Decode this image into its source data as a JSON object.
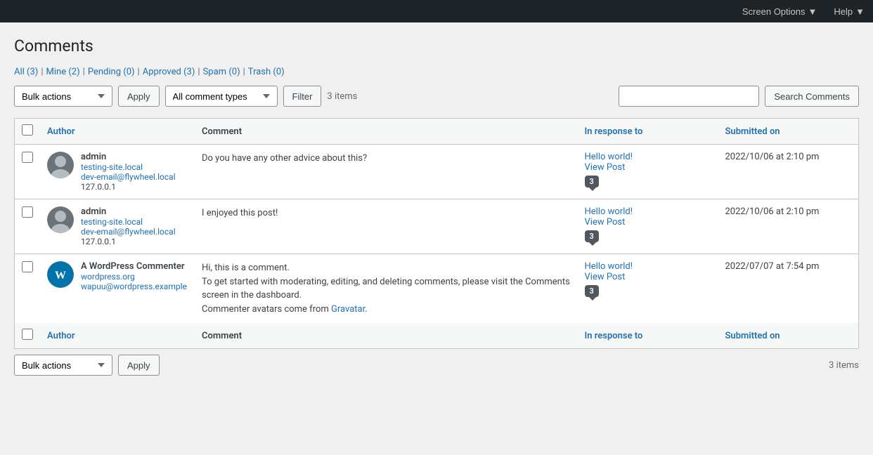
{
  "topbar": {
    "screen_options_label": "Screen Options",
    "help_label": "Help"
  },
  "page": {
    "title": "Comments"
  },
  "filters": {
    "all_label": "All",
    "all_count": "(3)",
    "mine_label": "Mine",
    "mine_count": "(2)",
    "pending_label": "Pending",
    "pending_count": "(0)",
    "approved_label": "Approved",
    "approved_count": "(3)",
    "spam_label": "Spam",
    "spam_count": "(0)",
    "trash_label": "Trash",
    "trash_count": "(0)"
  },
  "toolbar_top": {
    "bulk_actions_label": "Bulk actions",
    "apply_label": "Apply",
    "comment_type_label": "All comment types",
    "filter_label": "Filter",
    "items_count": "3 items",
    "search_placeholder": "",
    "search_button_label": "Search Comments"
  },
  "table": {
    "col_author": "Author",
    "col_comment": "Comment",
    "col_response": "In response to",
    "col_submitted": "Submitted on"
  },
  "comments": [
    {
      "id": 1,
      "author_name": "admin",
      "author_site": "testing-site.local",
      "author_email": "dev-email@flywheel.local",
      "author_ip": "127.0.0.1",
      "comment_text": "Do you have any other advice about this?",
      "response_title": "Hello world!",
      "response_link": "View Post",
      "response_count": "3",
      "submitted": "2022/10/06 at 2:10 pm",
      "avatar_type": "admin"
    },
    {
      "id": 2,
      "author_name": "admin",
      "author_site": "testing-site.local",
      "author_email": "dev-email@flywheel.local",
      "author_ip": "127.0.0.1",
      "comment_text": "I enjoyed this post!",
      "response_title": "Hello world!",
      "response_link": "View Post",
      "response_count": "3",
      "submitted": "2022/10/06 at 2:10 pm",
      "avatar_type": "admin"
    },
    {
      "id": 3,
      "author_name": "A WordPress Commenter",
      "author_site": "wordpress.org",
      "author_email": "wapuu@wordpress.example",
      "author_ip": "",
      "comment_text_parts": [
        "Hi, this is a comment.",
        "To get started with moderating, editing, and deleting comments, please visit the Comments screen in the dashboard.",
        "Commenter avatars come from "
      ],
      "comment_gravatar_text": "Gravatar",
      "comment_text_end": ".",
      "response_title": "Hello world!",
      "response_link": "View Post",
      "response_count": "3",
      "submitted": "2022/07/07 at 7:54 pm",
      "avatar_type": "wp"
    }
  ],
  "toolbar_bottom": {
    "bulk_actions_label": "Bulk actions",
    "apply_label": "Apply",
    "items_count": "3 items"
  }
}
